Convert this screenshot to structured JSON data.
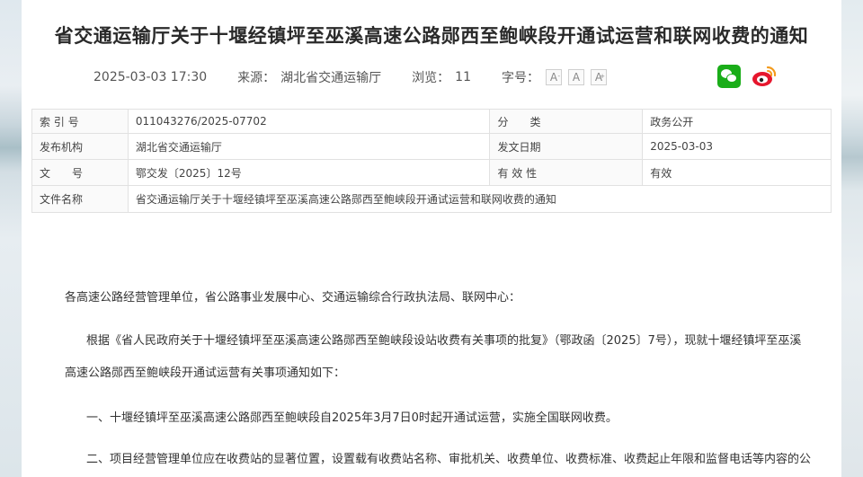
{
  "article": {
    "title": "省交通运输厅关于十堰经镇坪至巫溪高速公路郧西至鲍峡段开通试运营和联网收费的通知",
    "date": "2025-03-03 17:30",
    "source_label": "来源：",
    "source": "湖北省交通运输厅",
    "views_label": "浏览：",
    "views": "11",
    "font_size_label": "字号：",
    "font_size_buttons": [
      "A",
      "A",
      "A"
    ],
    "font_size_marks": [
      "-",
      "",
      "+"
    ]
  },
  "share": {
    "icons": [
      "wechat-icon",
      "weibo-icon"
    ],
    "wechat_color": "#1aad19",
    "weibo_color": "#e6162d"
  },
  "info_table": {
    "rows": [
      {
        "k1": "索 引 号",
        "v1": "011043276/2025-07702",
        "k2": "分　　类",
        "v2": "政务公开"
      },
      {
        "k1": "发布机构",
        "v1": "湖北省交通运输厅",
        "k2": "发文日期",
        "v2": "2025-03-03"
      },
      {
        "k1": "文　　号",
        "v1": "鄂交发〔2025〕12号",
        "k2": "有 效 性",
        "v2": "有效"
      },
      {
        "k1": "文件名称",
        "v1": "省交通运输厅关于十堰经镇坪至巫溪高速公路郧西至鲍峡段开通试运营和联网收费的通知"
      }
    ]
  },
  "content": {
    "paragraphs": [
      "各高速公路经营管理单位，省公路事业发展中心、交通运输综合行政执法局、联网中心：",
      "根据《省人民政府关于十堰经镇坪至巫溪高速公路郧西至鲍峡段设站收费有关事项的批复》（鄂政函〔2025〕7号），现就十堰经镇坪至巫溪",
      "高速公路郧西至鲍峡段开通试运营有关事项通知如下：",
      "一、十堰经镇坪至巫溪高速公路郧西至鲍峡段自2025年3月7日0时起开通试运营，实施全国联网收费。",
      "二、项目经营管理单位应在收费站的显著位置，设置载有收费站名称、审批机关、收费单位、收费标准、收费起止年限和监督电话等内容的公"
    ]
  }
}
